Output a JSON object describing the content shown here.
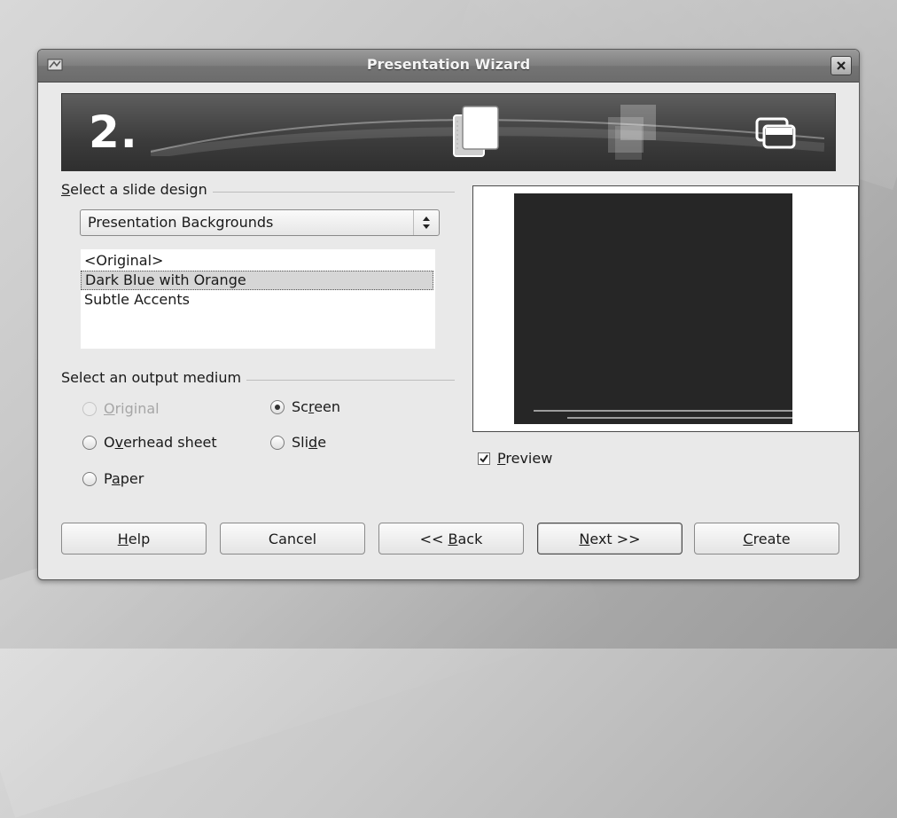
{
  "window": {
    "title": "Presentation Wizard"
  },
  "banner": {
    "step_number": "2."
  },
  "slide_design": {
    "section_label_mnemonic": "S",
    "section_label_rest": "elect a slide design",
    "combo_value": "Presentation Backgrounds",
    "list_items": [
      "<Original>",
      "Dark Blue with Orange",
      "Subtle Accents"
    ],
    "selected_index": 1
  },
  "output_medium": {
    "section_label": "Select an output medium",
    "options": {
      "original": {
        "pre": "",
        "mn": "O",
        "post": "riginal",
        "checked": false,
        "enabled": false
      },
      "screen": {
        "pre": "Sc",
        "mn": "r",
        "post": "een",
        "checked": true,
        "enabled": true
      },
      "overhead": {
        "pre": "O",
        "mn": "v",
        "post": "erhead sheet",
        "checked": false,
        "enabled": true
      },
      "slide": {
        "pre": "Sli",
        "mn": "d",
        "post": "e",
        "checked": false,
        "enabled": true
      },
      "paper": {
        "pre": "P",
        "mn": "a",
        "post": "per",
        "checked": false,
        "enabled": true
      }
    }
  },
  "preview": {
    "checkbox_mn": "P",
    "checkbox_rest": "review",
    "checked": true
  },
  "buttons": {
    "help": {
      "pre": "",
      "mn": "H",
      "post": "elp"
    },
    "cancel": {
      "pre": "Cancel",
      "mn": "",
      "post": ""
    },
    "back": {
      "pre": "<< ",
      "mn": "B",
      "post": "ack"
    },
    "next": {
      "pre": "",
      "mn": "N",
      "post": "ext >>"
    },
    "create": {
      "pre": "",
      "mn": "C",
      "post": "reate"
    }
  }
}
